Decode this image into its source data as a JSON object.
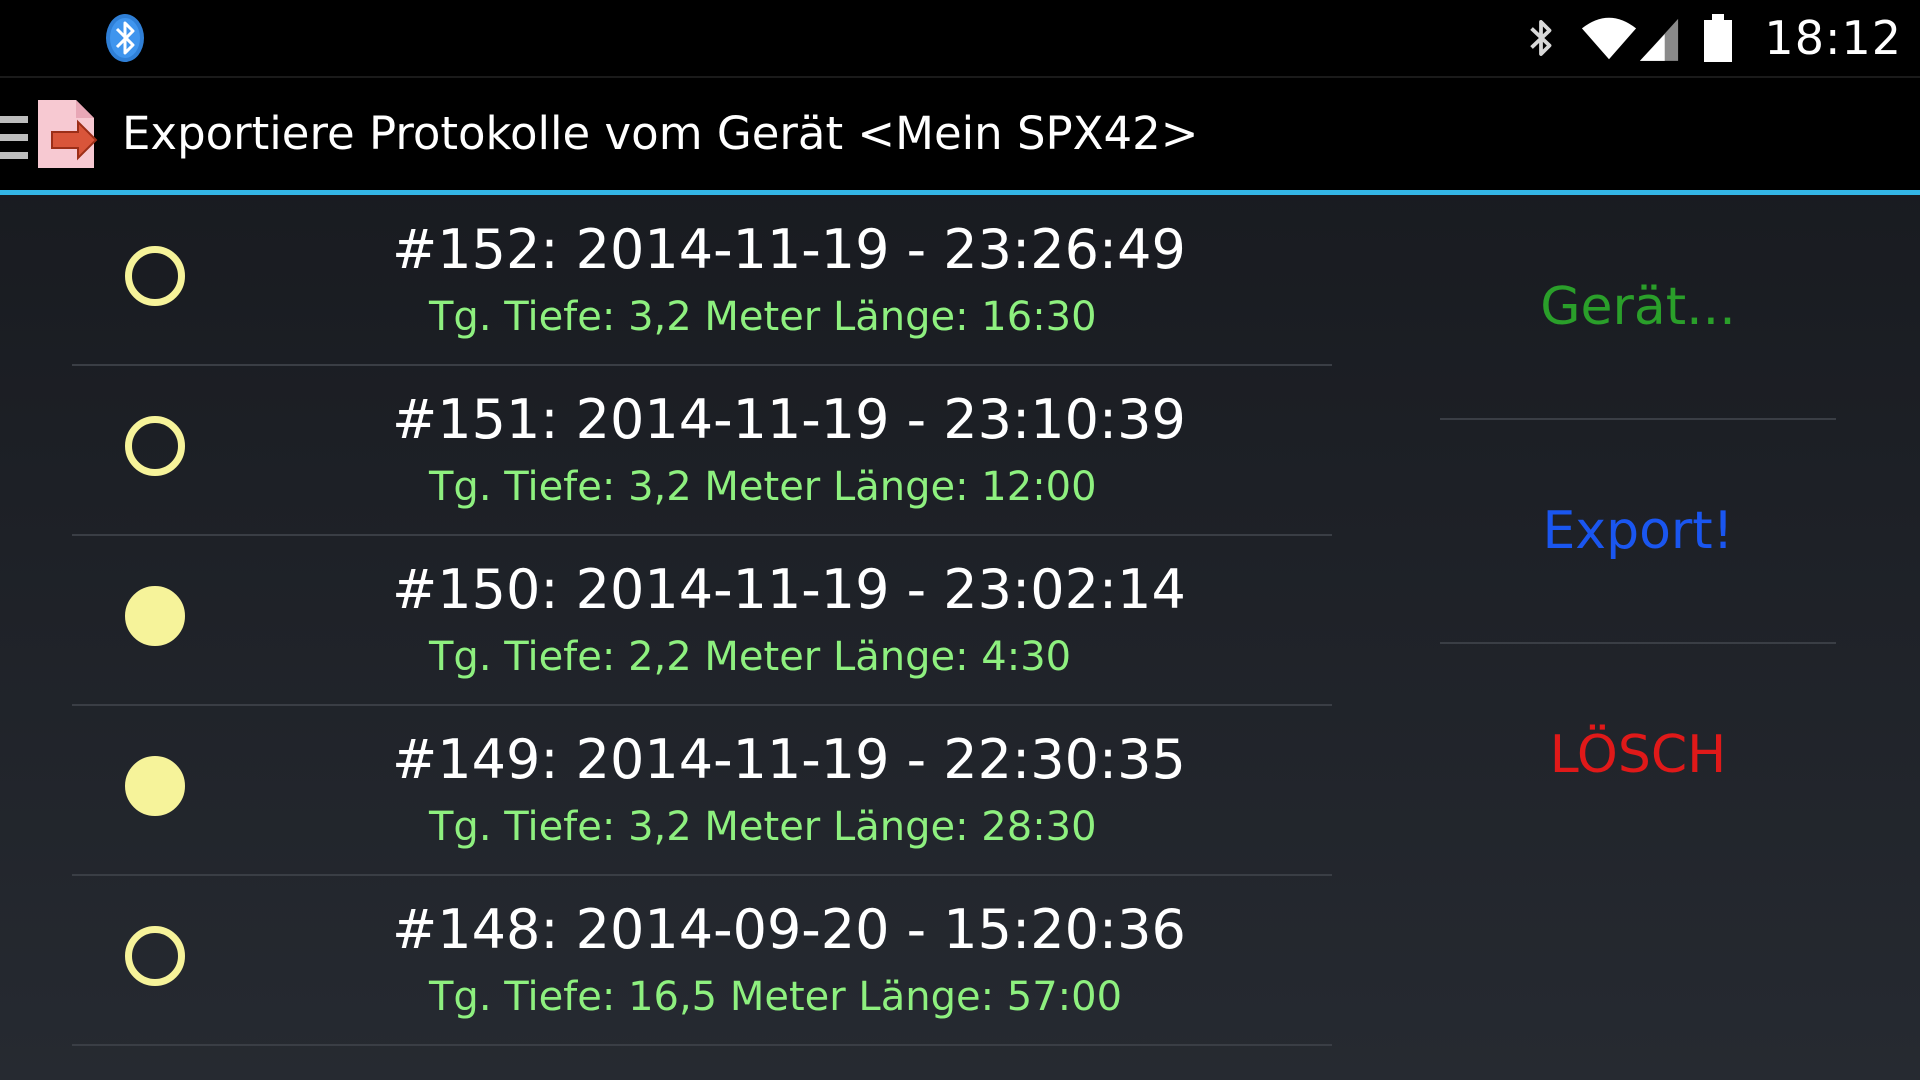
{
  "status_bar": {
    "time": "18:12",
    "icons": [
      "bluetooth-notification-icon",
      "bluetooth-icon",
      "wifi-icon",
      "signal-icon",
      "battery-icon"
    ]
  },
  "action_bar": {
    "title": "Exportiere Protokolle vom Gerät <Mein SPX42>",
    "icons": [
      "drawer-icon",
      "export-app-icon"
    ]
  },
  "logs": [
    {
      "title": "#152: 2014-11-19 - 23:26:49",
      "details": "Tg. Tiefe: 3,2 Meter Länge: 16:30",
      "selected": false
    },
    {
      "title": "#151: 2014-11-19 - 23:10:39",
      "details": "Tg. Tiefe: 3,2 Meter Länge: 12:00",
      "selected": false
    },
    {
      "title": "#150: 2014-11-19 - 23:02:14",
      "details": "Tg. Tiefe: 2,2 Meter Länge: 4:30",
      "selected": true
    },
    {
      "title": "#149: 2014-11-19 - 22:30:35",
      "details": "Tg. Tiefe: 3,2 Meter Länge: 28:30",
      "selected": true
    },
    {
      "title": "#148: 2014-09-20 - 15:20:36",
      "details": "Tg. Tiefe: 16,5 Meter Länge: 57:00",
      "selected": false
    }
  ],
  "buttons": {
    "device": "Gerät...",
    "export": "Export!",
    "delete": "LÖSCH"
  },
  "colors": {
    "accent": "#33b5e5",
    "radio": "#f6f39a",
    "details_text": "#8ef07f",
    "device_button": "#2a9f2a",
    "export_button": "#1a56f0",
    "delete_button": "#e01919"
  }
}
